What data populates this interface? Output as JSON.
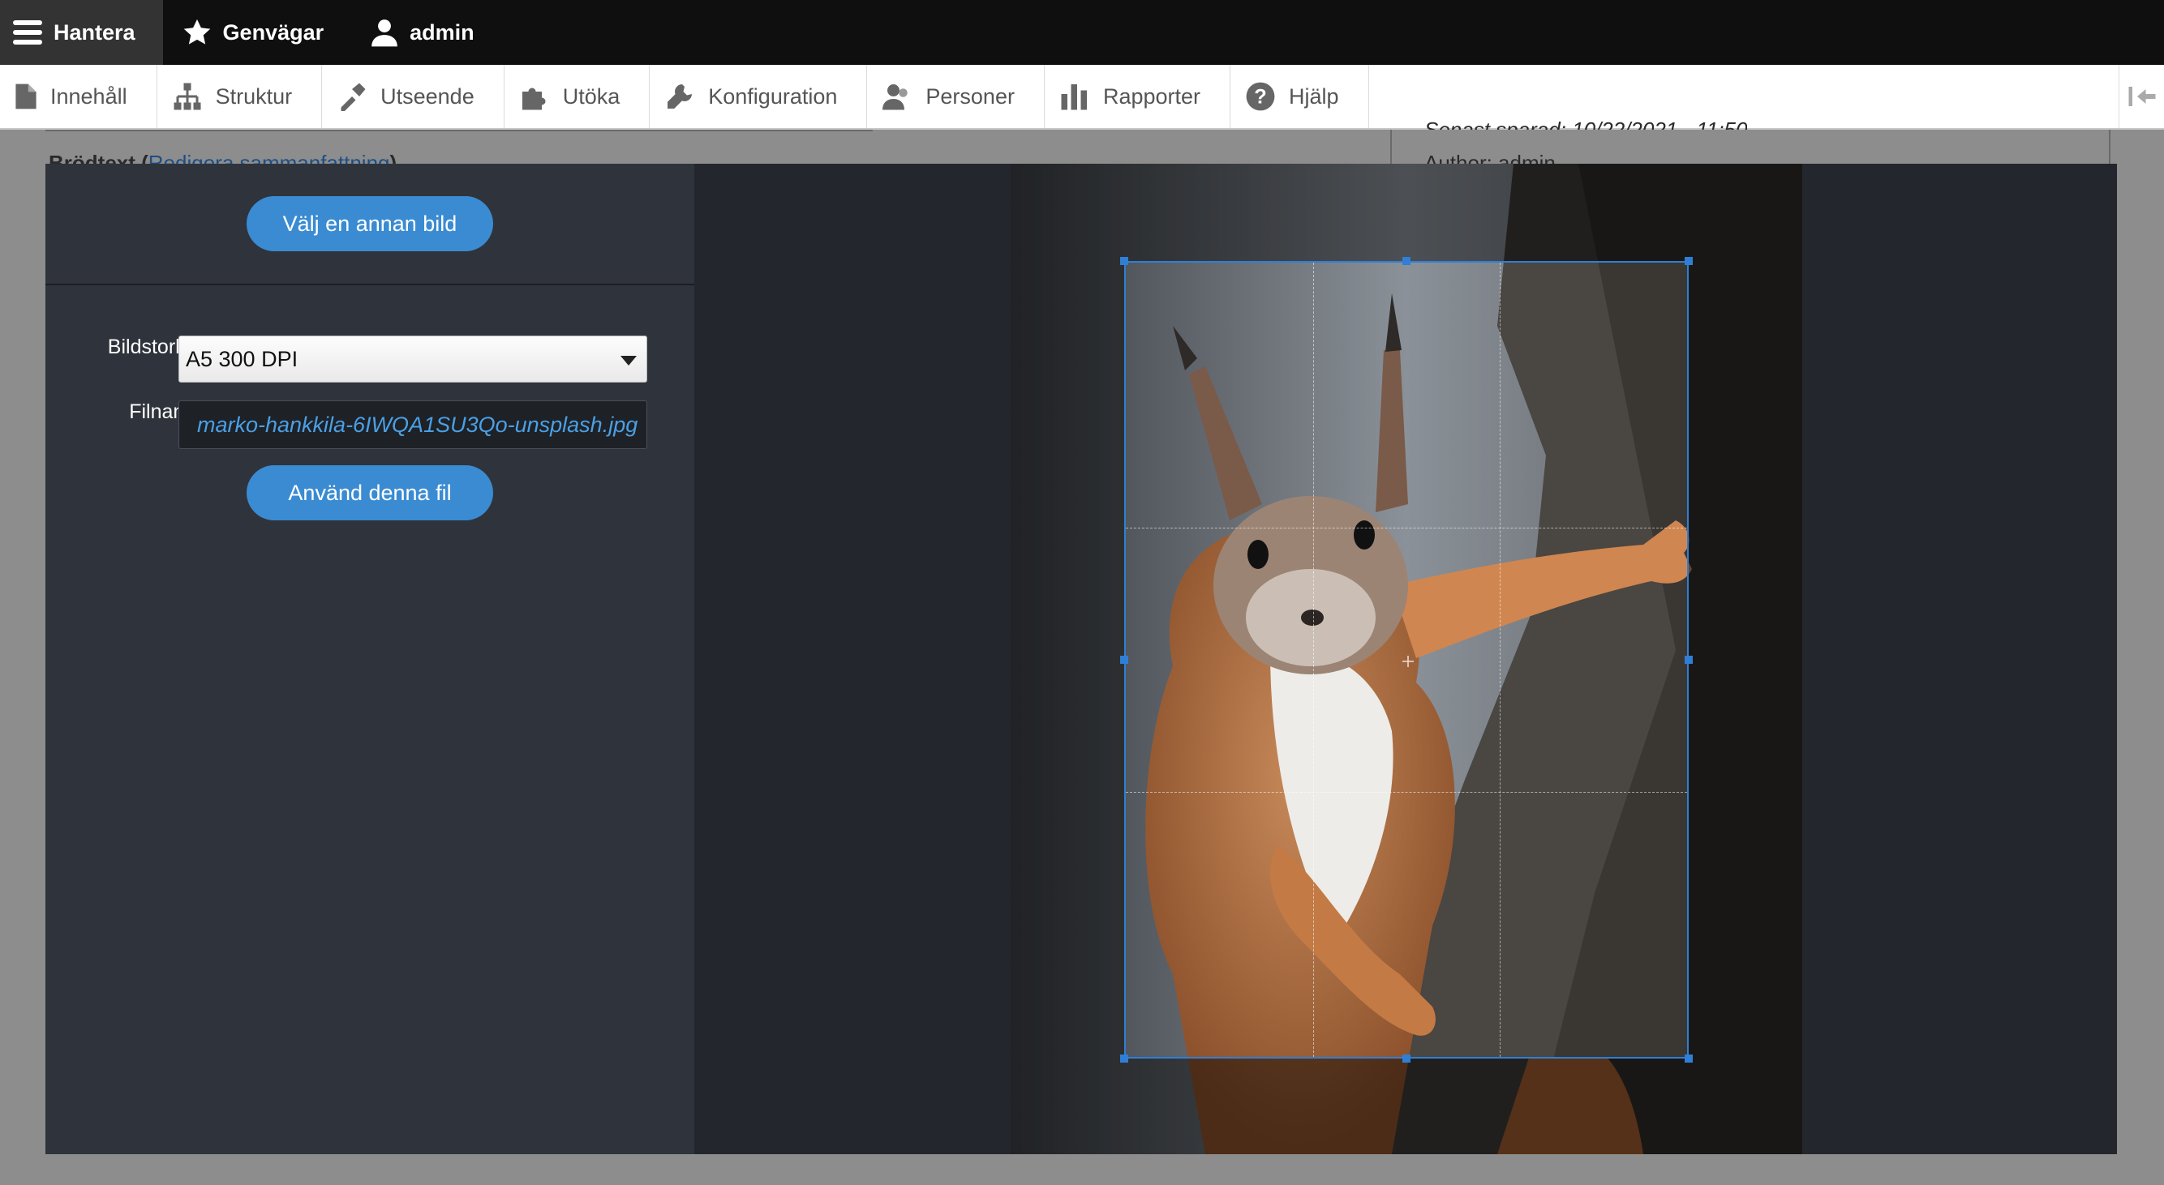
{
  "toolbar": {
    "manage_label": "Hantera",
    "shortcuts_label": "Genvägar",
    "user_label": "admin"
  },
  "admin_menu": {
    "items": [
      {
        "label": "Innehåll",
        "icon": "file-icon"
      },
      {
        "label": "Struktur",
        "icon": "structure-icon"
      },
      {
        "label": "Utseende",
        "icon": "brush-icon"
      },
      {
        "label": "Utöka",
        "icon": "puzzle-icon"
      },
      {
        "label": "Konfiguration",
        "icon": "wrench-icon"
      },
      {
        "label": "Personer",
        "icon": "people-icon"
      },
      {
        "label": "Rapporter",
        "icon": "bar-chart-icon"
      },
      {
        "label": "Hjälp",
        "icon": "help-icon"
      }
    ]
  },
  "background_page": {
    "body_label": "Brödtext (",
    "summary_link": "Redigera sammanfattning",
    "body_label_end": ")",
    "last_saved": "Senast sparad: 10/22/2021 - 11:50",
    "author": "Author: admin"
  },
  "editor": {
    "choose_other_button": "Välj en annan bild",
    "size_label": "Bildstorlek :",
    "size_value": "A5 300 DPI",
    "filename_label": "Filnamn :",
    "filename_value": "marko-hankkila-6IWQA1SU3Qo-unsplash.jpg",
    "use_file_button": "Använd denna fil"
  },
  "colors": {
    "accent": "#3a8bd2",
    "crop_border": "#2f7fd6",
    "toolbar_bg": "#0f0f0f",
    "modal_bg": "#23272d",
    "sidebar_bg": "#2f333b"
  }
}
